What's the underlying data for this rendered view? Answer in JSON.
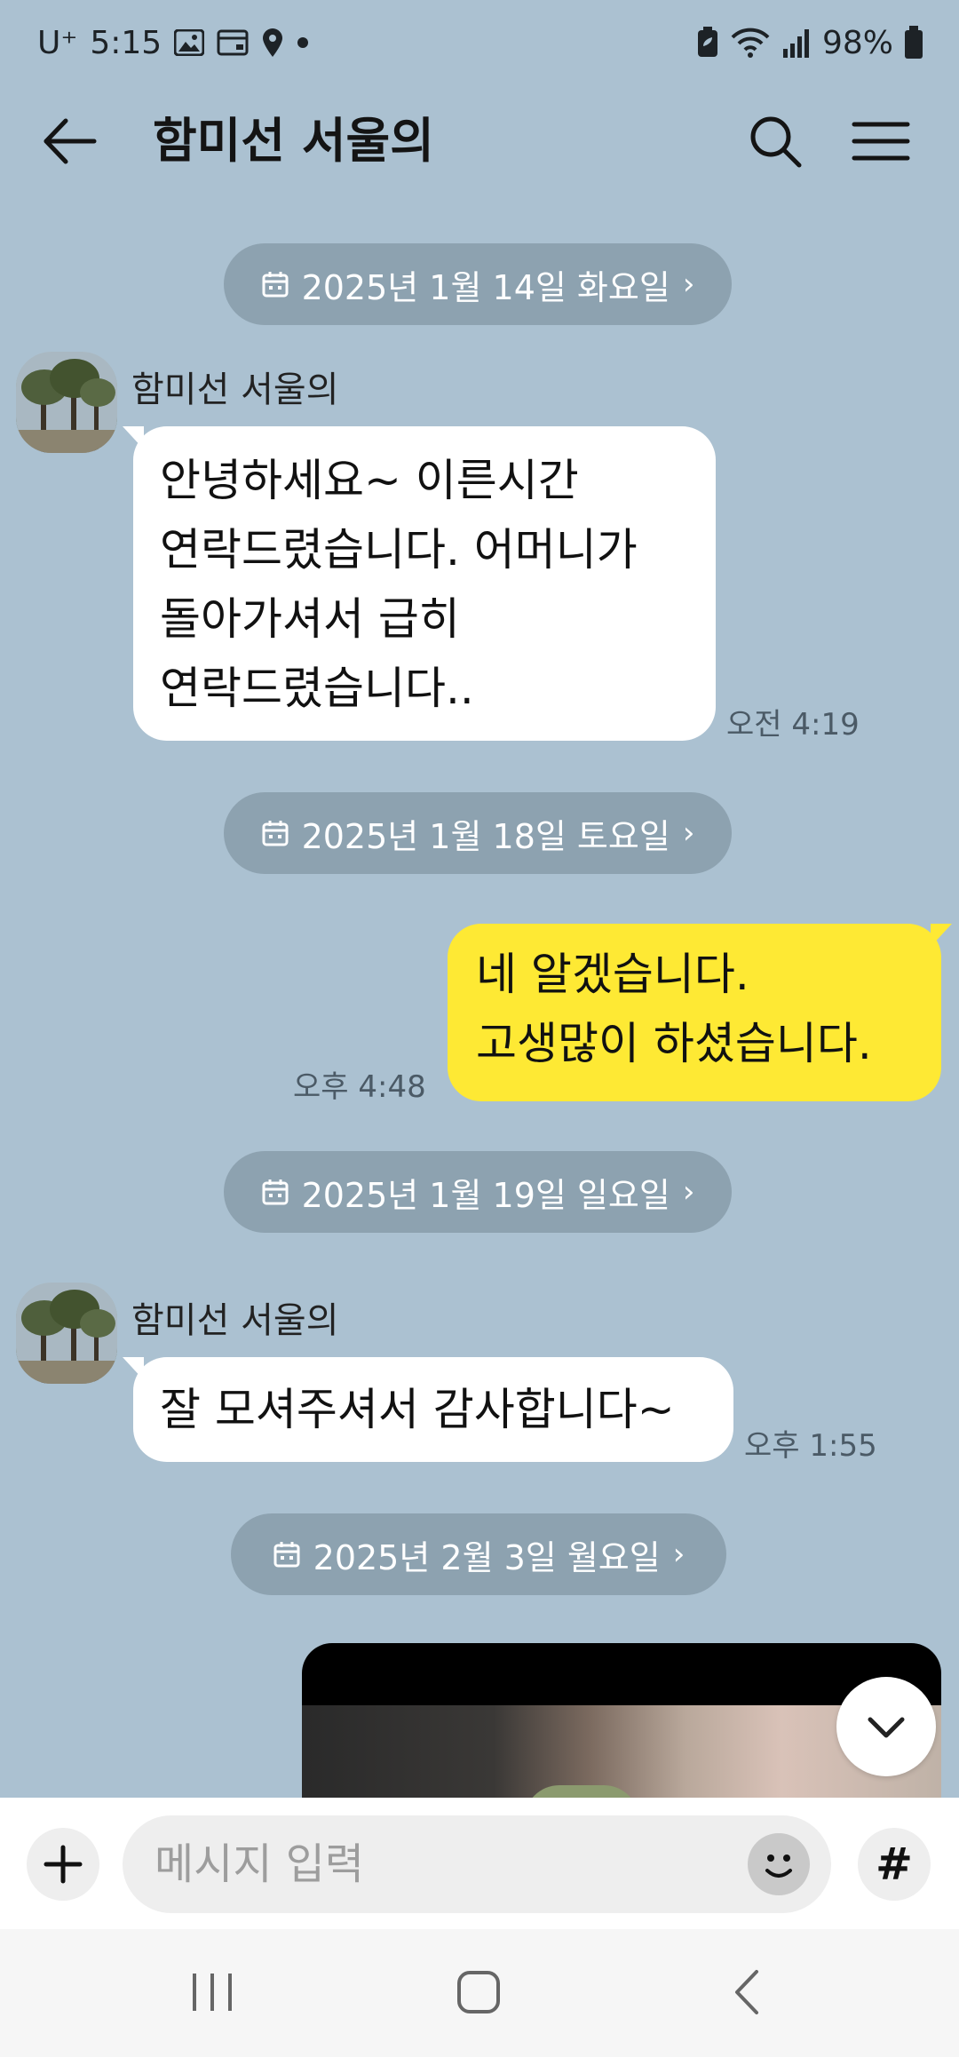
{
  "status_bar": {
    "carrier": "U⁺",
    "time": "5:15",
    "battery": "98%"
  },
  "header": {
    "title": "함미선 서울의"
  },
  "messages": {
    "date1": "2025년 1월 14일 화요일",
    "date2": "2025년 1월 18일 토요일",
    "date3": "2025년 1월 19일 일요일",
    "date4": "2025년 2월 3일 월요일",
    "in1_sender": "함미선 서울의",
    "in1_lines": [
      "안녕하세요~ 이른시간",
      "연락드렸습니다. 어머니가",
      "돌아가셔서 급히",
      "연락드렸습니다.."
    ],
    "in1_time": "오전 4:19",
    "out1_lines": [
      "네 알겠습니다.",
      "고생많이 하셨습니다."
    ],
    "out1_time": "오후 4:48",
    "in2_sender": "함미선 서울의",
    "in2_text": "잘 모셔주셔서 감사합니다~",
    "in2_time": "오후 1:55"
  },
  "input": {
    "placeholder": "메시지 입력",
    "hash_label": "#"
  },
  "colors": {
    "chat_background": "#abc1d1",
    "outgoing_bubble": "#fee934",
    "incoming_bubble": "#ffffff"
  }
}
